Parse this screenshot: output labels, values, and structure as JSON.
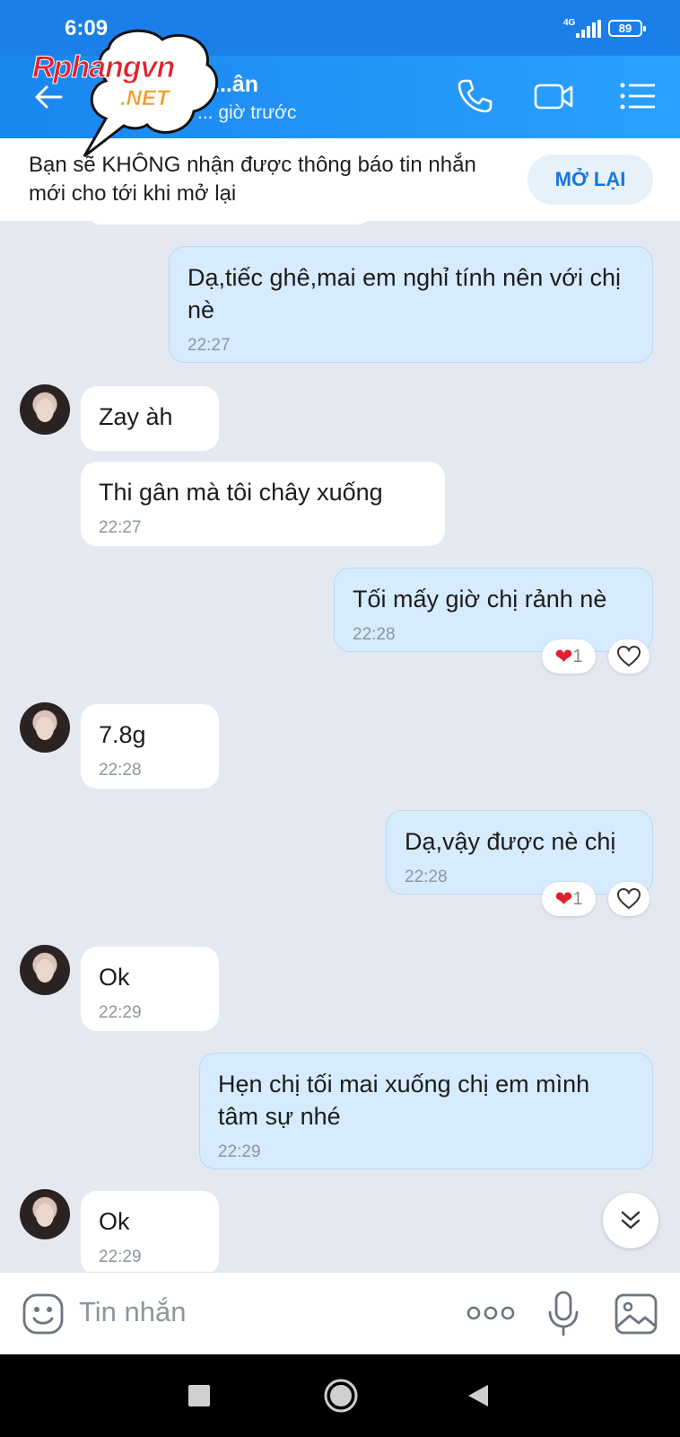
{
  "status_bar": {
    "time": "6:09",
    "network": "4G",
    "battery": "89"
  },
  "header": {
    "contact_name": "...ân",
    "last_seen": "... giờ trước"
  },
  "watermark": {
    "brand": "Rphangvn",
    "suffix": ".NET"
  },
  "notice": {
    "text": "Bạn sẽ KHÔNG nhận được thông báo tin nhắn mới cho tới khi mở lại",
    "button": "MỞ LẠI"
  },
  "messages": [
    {
      "side": "sent",
      "text": "Dạ,tiếc ghê,mai em nghỉ tính nên với chị nè",
      "time": "22:27"
    },
    {
      "side": "received",
      "text": "Zay àh",
      "time": ""
    },
    {
      "side": "received",
      "text": "Thi gân mà tôi chây xuống",
      "time": "22:27"
    },
    {
      "side": "sent",
      "text": "Tối mấy giờ chị rảnh nè",
      "time": "22:28",
      "reactions": 1
    },
    {
      "side": "received",
      "text": "7.8g",
      "time": "22:28"
    },
    {
      "side": "sent",
      "text": "Dạ,vậy được nè chị",
      "time": "22:28",
      "reactions": 1
    },
    {
      "side": "received",
      "text": "Ok",
      "time": "22:29"
    },
    {
      "side": "sent",
      "text": "Hẹn chị tối mai xuống chị em mình tâm sự nhé",
      "time": "22:29"
    },
    {
      "side": "received",
      "text": "Ok",
      "time": "22:29"
    }
  ],
  "composer": {
    "placeholder": "Tin nhắn"
  },
  "icons": {
    "back": "arrow-left-icon",
    "call": "phone-icon",
    "video": "video-camera-icon",
    "menu": "list-icon",
    "emoji": "emoji-icon",
    "more": "more-dots-icon",
    "mic": "microphone-icon",
    "image": "image-icon",
    "scroll": "chevron-double-down-icon"
  },
  "colors": {
    "header": "#1a86f0",
    "sent_bubble": "#d6ebfd",
    "received_bubble": "#ffffff",
    "background": "#e4e9f1",
    "accent": "#1677d8"
  }
}
